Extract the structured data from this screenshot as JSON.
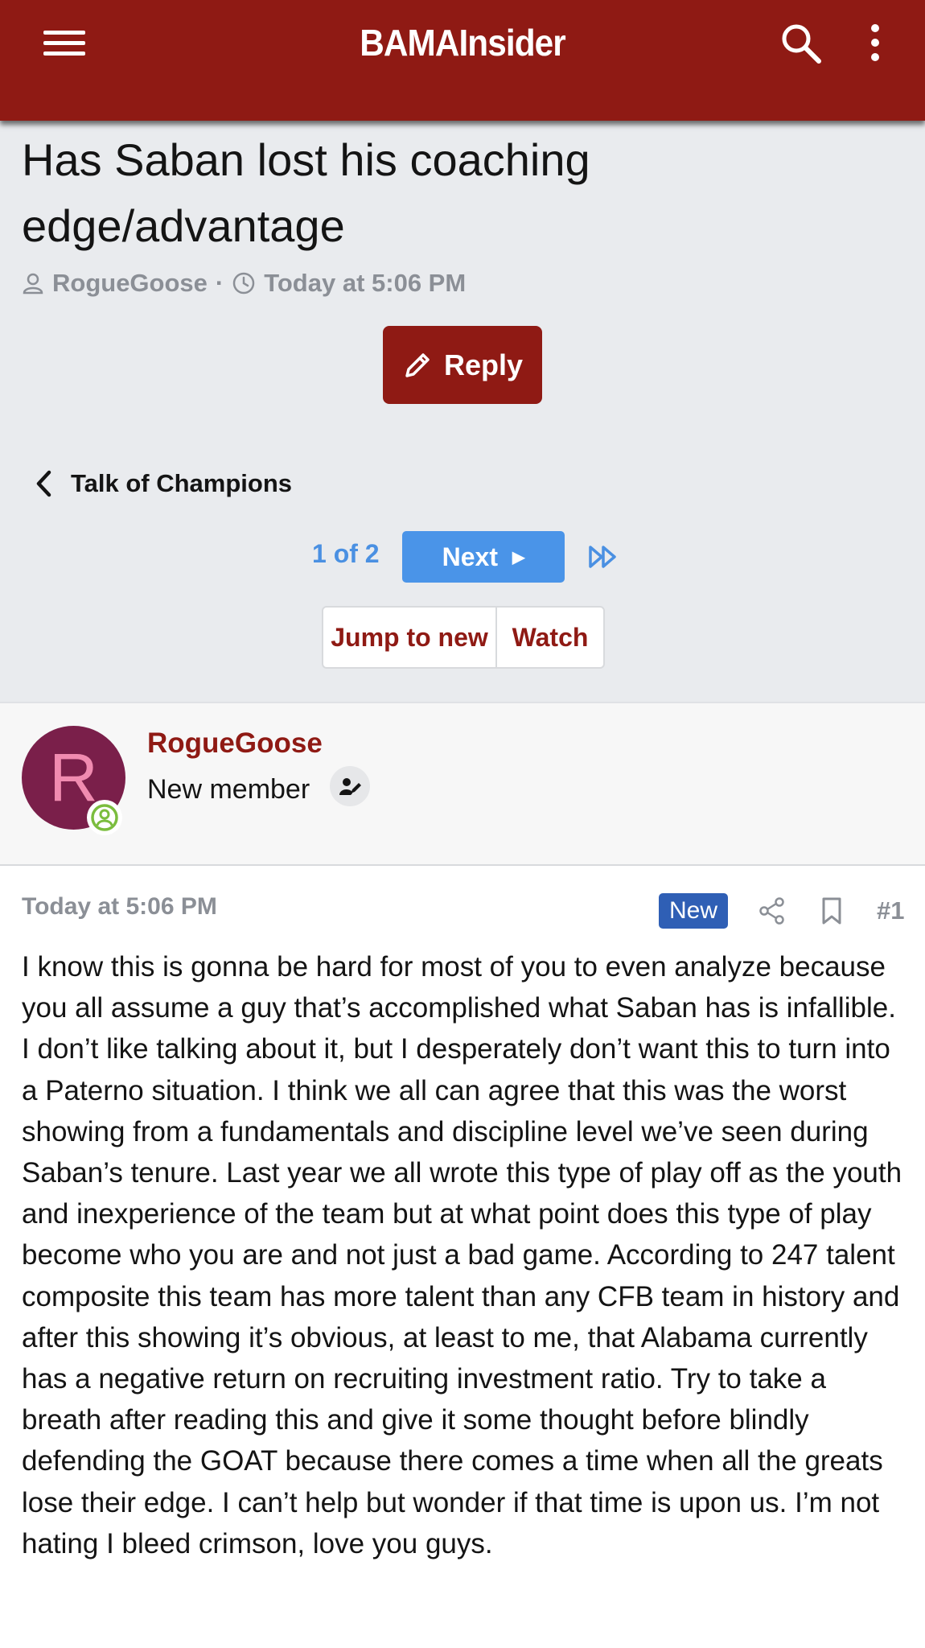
{
  "header": {
    "logo": "BAMAInsider",
    "icons": [
      "menu-icon",
      "search-icon",
      "more-vertical-icon"
    ]
  },
  "thread": {
    "title": "Has Saban lost his coaching edge/advantage",
    "author": "RogueGoose",
    "separator": "·",
    "time": "Today at 5:06 PM",
    "reply_label": "Reply"
  },
  "nav": {
    "back_label": "Talk of Champions",
    "page_count": "1 of 2",
    "next_label": "Next",
    "jump_to_new_label": "Jump to new",
    "watch_label": "Watch"
  },
  "user": {
    "avatar_letter": "R",
    "name": "RogueGoose",
    "title": "New member"
  },
  "post": {
    "date": "Today at 5:06 PM",
    "badge": "New",
    "number": "#1",
    "body": "I know this is gonna be hard for most of you to even analyze because you all assume a guy that’s accomplished what Saban has is infallible. I don’t like talking about it, but I desperately don’t want this to turn into a Paterno situation. I think we all can agree that this was the worst showing from a fundamentals and discipline level we’ve seen during Saban’s tenure. Last year we all wrote this type of play off as the youth and inexperience of the team but at what point does this type of play become who you are and not just a bad game. According to 247 talent composite this team has more talent than any CFB team in history and after this showing it’s obvious, at least to me, that Alabama currently has a negative return on recruiting investment ratio. Try to take a breath after reading this and give it some thought before blindly defending the GOAT because there comes a time when all the greats lose their edge. I can’t help but wonder if that time is upon us. I’m not hating I bleed crimson, love you guys."
  },
  "colors": {
    "brand": "#8f1a14",
    "link_blue": "#4a94e8",
    "new_badge": "#2f5fb5",
    "muted": "#8b8f96"
  }
}
